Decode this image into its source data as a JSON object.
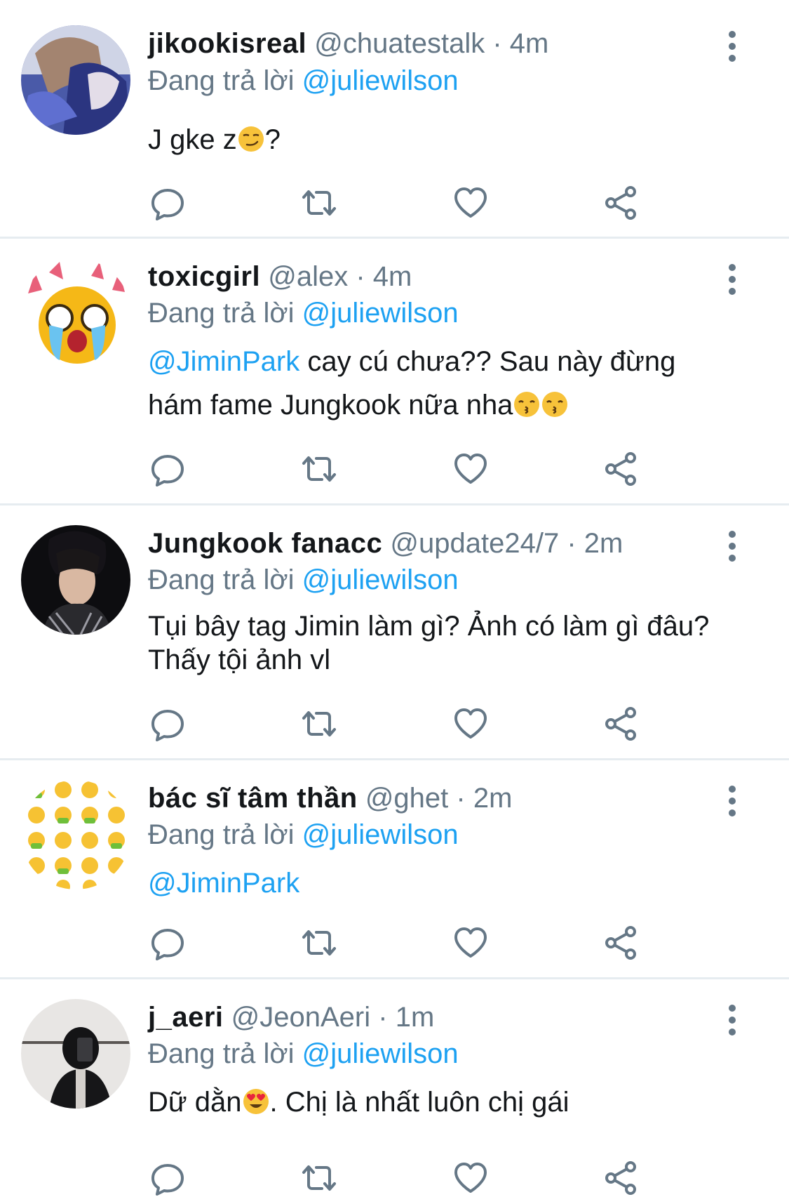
{
  "reply_prefix": "Đang trả lời",
  "tweets": [
    {
      "name": "jikookisreal",
      "handle": "@chuatestalk",
      "separator": "·",
      "time": "4m",
      "reply_to": "@juliewilson",
      "mention": "",
      "text_1": "J gke z",
      "emoji_1": "smirking-face",
      "text_2": "?"
    },
    {
      "name": "toxicgirl",
      "handle": "@alex",
      "separator": "·",
      "time": "4m",
      "reply_to": "@juliewilson",
      "mention": "@JiminPark",
      "text_1": " cay cú chưa?? Sau này đừng hám fame Jungkook nữa nha",
      "emoji_1": "kissing-face",
      "emoji_2": "kissing-face"
    },
    {
      "name": "Jungkook fanacc",
      "handle": "@update24/7",
      "separator": "·",
      "time": "2m",
      "reply_to": "@juliewilson",
      "text_1": "Tụi bây tag Jimin làm gì? Ảnh có làm gì đâu? Thấy tội ảnh vl"
    },
    {
      "name": "bác sĩ tâm thần",
      "handle": "@ghet",
      "separator": "·",
      "time": "2m",
      "reply_to": "@juliewilson",
      "mention": "@JiminPark"
    },
    {
      "name": "j_aeri",
      "handle": "@JeonAeri",
      "separator": "·",
      "time": "1m",
      "reply_to": "@juliewilson",
      "text_1": "Dữ dằn",
      "emoji_1": "heart-eyes-face",
      "text_2": ". Chị là nhất luôn chị gái"
    }
  ],
  "icons": [
    "reply-icon",
    "retweet-icon",
    "like-icon",
    "share-icon",
    "more-icon"
  ],
  "colors": {
    "accent": "#1da1f2",
    "secondary_text": "#657786",
    "primary_text": "#14171a",
    "divider": "#e6ecf0"
  }
}
